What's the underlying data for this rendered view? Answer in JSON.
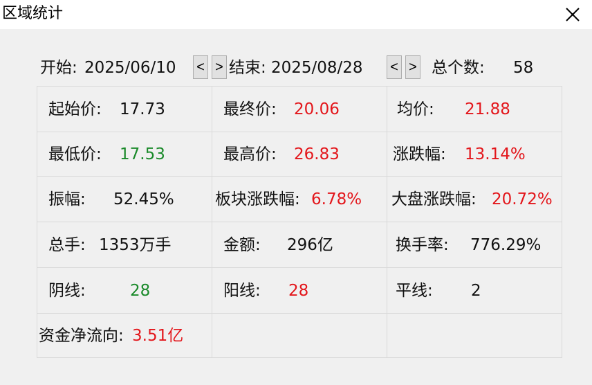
{
  "window": {
    "title": "区域统计",
    "close_icon": "close-icon"
  },
  "range": {
    "start_label": "开始:",
    "start_date": "2025/06/10",
    "end_label": "结束:",
    "end_date": "2025/08/28",
    "prev_symbol": "<",
    "next_symbol": ">",
    "count_label": "总个数:",
    "count_value": "58"
  },
  "stats": {
    "open_price": {
      "label": "起始价:",
      "value": "17.73"
    },
    "close_price": {
      "label": "最终价:",
      "value": "20.06"
    },
    "avg_price": {
      "label": "均价:",
      "value": "21.88"
    },
    "low_price": {
      "label": "最低价:",
      "value": "17.53"
    },
    "high_price": {
      "label": "最高价:",
      "value": "26.83"
    },
    "change_pct": {
      "label": "涨跌幅:",
      "value": "13.14%"
    },
    "amplitude": {
      "label": "振幅:",
      "value": "52.45%"
    },
    "sector_change": {
      "label": "板块涨跌幅:",
      "value": "6.78%"
    },
    "market_change": {
      "label": "大盘涨跌幅:",
      "value": "20.72%"
    },
    "total_volume": {
      "label": "总手:",
      "value": "1353万手"
    },
    "amount": {
      "label": "金额:",
      "value": "296亿"
    },
    "turnover": {
      "label": "换手率:",
      "value": "776.29%"
    },
    "down_days": {
      "label": "阴线:",
      "value": "28"
    },
    "up_days": {
      "label": "阳线:",
      "value": "28"
    },
    "flat_days": {
      "label": "平线:",
      "value": "2"
    },
    "net_flow": {
      "label": "资金净流向:",
      "value": "3.51亿"
    }
  },
  "colors": {
    "up": "#e3161b",
    "down": "#1a8a2a",
    "neutral": "#111111"
  }
}
